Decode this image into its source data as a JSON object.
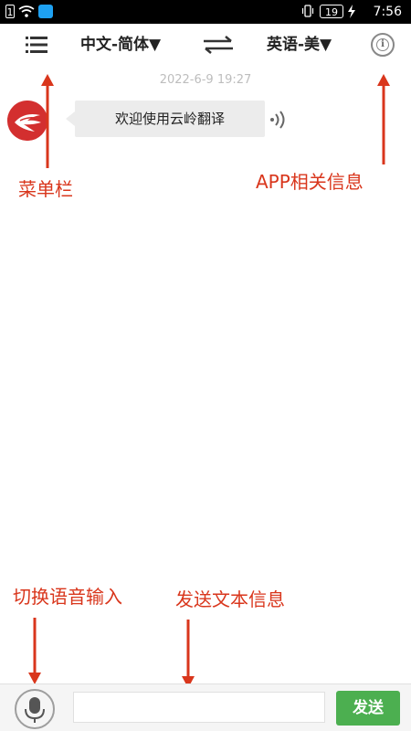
{
  "status_bar": {
    "sim_label": "1",
    "battery_level": "19",
    "time": "7:56",
    "icons": [
      "sim-icon",
      "wifi-icon",
      "app-notification-icon",
      "vibrate-icon",
      "battery-icon",
      "charging-icon"
    ]
  },
  "toolbar": {
    "menu_icon": "menu-icon",
    "source_language": "中文-简体▼",
    "target_language": "英语-美▼",
    "swap_icon": "swap-arrows-icon",
    "info_icon": "info-icon",
    "info_glyph": "i"
  },
  "chat": {
    "timestamp": "2022-6-9 19:27",
    "messages": [
      {
        "sender_avatar": "app-logo-avatar",
        "text": "欢迎使用云岭翻译",
        "action_icon": "speaker-icon"
      }
    ]
  },
  "annotations": {
    "menu_bar": "菜单栏",
    "app_info": "APP相关信息",
    "switch_voice": "切换语音输入",
    "send_text": "发送文本信息",
    "color": "#d9361c"
  },
  "input_bar": {
    "voice_icon": "microphone-icon",
    "input_value": "",
    "input_placeholder": "",
    "send_label": "发送",
    "send_color": "#4caf50"
  }
}
